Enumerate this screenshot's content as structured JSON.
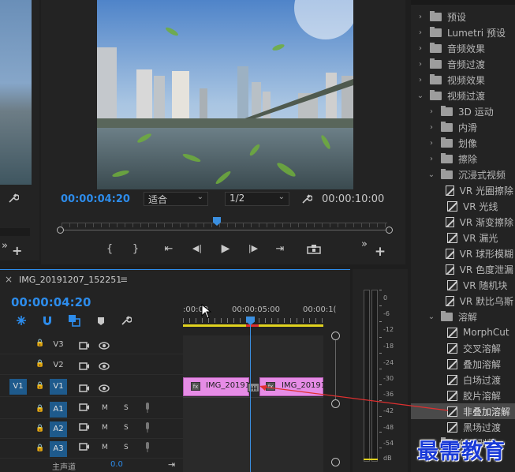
{
  "program_monitor": {
    "timecode_current": "00:00:04:20",
    "fit_select": "适合",
    "resolution_select": "1/2",
    "timecode_duration": "00:00:10:00"
  },
  "transport": {
    "mark_in": "{",
    "mark_out": "}",
    "go_in": "⇤",
    "step_back": "◀|",
    "play": "▶",
    "step_fwd": "|▶",
    "go_out": "⇥",
    "more": "»",
    "add": "+"
  },
  "timeline": {
    "close": "×",
    "sequence_name": "IMG_20191207_152251",
    "menu": "≡",
    "timecode": "00:00:04:20",
    "ruler_labels": [
      ":00:00",
      "00:00:05:00",
      "00:00:1("
    ],
    "tracks": [
      {
        "source": "",
        "name": "V3",
        "lock": "🔒",
        "kind": "video"
      },
      {
        "source": "",
        "name": "V2",
        "lock": "🔒",
        "kind": "video"
      },
      {
        "source": "V1",
        "name": "V1",
        "lock": "🔒",
        "kind": "video"
      },
      {
        "source": "",
        "name": "A1",
        "lock": "🔒",
        "kind": "audio"
      },
      {
        "source": "",
        "name": "A2",
        "lock": "🔒",
        "kind": "audio"
      },
      {
        "source": "",
        "name": "A3",
        "lock": "🔒",
        "kind": "audio"
      }
    ],
    "master_label": "主声道",
    "master_value": "0.0",
    "clip_a": "IMG_20191",
    "clip_b": "IMG_20191",
    "audio_m": "M",
    "audio_s": "S"
  },
  "meter": {
    "ticks": [
      "0",
      "-6",
      "-12",
      "-18",
      "-24",
      "-30",
      "-36",
      "-42",
      "-48",
      "-54",
      "dB"
    ]
  },
  "effects": {
    "items": [
      {
        "type": "folder-star",
        "label": "预设",
        "level": 0,
        "open": false
      },
      {
        "type": "folder-star",
        "label": "Lumetri 预设",
        "level": 0,
        "open": false
      },
      {
        "type": "folder",
        "label": "音频效果",
        "level": 0,
        "open": false
      },
      {
        "type": "folder",
        "label": "音频过渡",
        "level": 0,
        "open": false
      },
      {
        "type": "folder",
        "label": "视频效果",
        "level": 0,
        "open": false
      },
      {
        "type": "folder",
        "label": "视频过渡",
        "level": 0,
        "open": true
      },
      {
        "type": "folder",
        "label": "3D 运动",
        "level": 1,
        "open": false
      },
      {
        "type": "folder",
        "label": "内滑",
        "level": 1,
        "open": false
      },
      {
        "type": "folder",
        "label": "划像",
        "level": 1,
        "open": false
      },
      {
        "type": "folder",
        "label": "擦除",
        "level": 1,
        "open": false
      },
      {
        "type": "folder",
        "label": "沉浸式视频",
        "level": 1,
        "open": true
      },
      {
        "type": "fx",
        "label": "VR 光圈擦除",
        "level": 2
      },
      {
        "type": "fx",
        "label": "VR 光线",
        "level": 2
      },
      {
        "type": "fx",
        "label": "VR 渐变擦除",
        "level": 2
      },
      {
        "type": "fx",
        "label": "VR 漏光",
        "level": 2
      },
      {
        "type": "fx",
        "label": "VR 球形模糊",
        "level": 2
      },
      {
        "type": "fx",
        "label": "VR 色度泄漏",
        "level": 2
      },
      {
        "type": "fx",
        "label": "VR 随机块",
        "level": 2
      },
      {
        "type": "fx",
        "label": "VR 默比乌斯",
        "level": 2
      },
      {
        "type": "folder",
        "label": "溶解",
        "level": 1,
        "open": true
      },
      {
        "type": "fx",
        "label": "MorphCut",
        "level": 2
      },
      {
        "type": "fx",
        "label": "交叉溶解",
        "level": 2
      },
      {
        "type": "fx",
        "label": "叠加溶解",
        "level": 2
      },
      {
        "type": "fx",
        "label": "白场过渡",
        "level": 2
      },
      {
        "type": "fx",
        "label": "胶片溶解",
        "level": 2
      },
      {
        "type": "fx",
        "label": "非叠加溶解",
        "level": 2,
        "highlight": true
      },
      {
        "type": "fx",
        "label": "黑场过渡",
        "level": 2
      },
      {
        "type": "folder",
        "label": "负面剥落",
        "level": 1,
        "open": false
      }
    ]
  },
  "watermark": "最需教育",
  "colors": {
    "accent_blue": "#2d8ceb",
    "clip_pink": "#e68ce6",
    "arrow_red": "#e03030",
    "playhead": "#3b8fe0"
  }
}
